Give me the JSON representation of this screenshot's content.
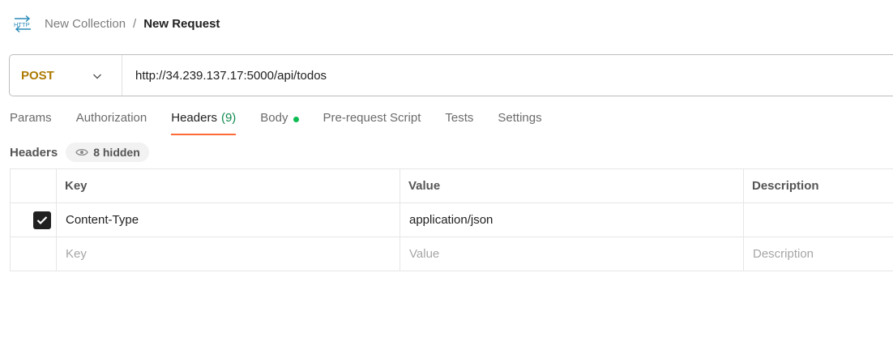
{
  "breadcrumb": {
    "icon": "http-icon",
    "collection": "New Collection",
    "separator": "/",
    "request": "New Request"
  },
  "request": {
    "method": "POST",
    "method_color": "#ad7a03",
    "url": "http://34.239.137.17:5000/api/todos"
  },
  "tabs": [
    {
      "label": "Params"
    },
    {
      "label": "Authorization"
    },
    {
      "label": "Headers",
      "count": "(9)",
      "active": true
    },
    {
      "label": "Body",
      "indicator": "green-dot"
    },
    {
      "label": "Pre-request Script"
    },
    {
      "label": "Tests"
    },
    {
      "label": "Settings"
    }
  ],
  "headers_section": {
    "title": "Headers",
    "hidden_label": "8 hidden",
    "hidden_icon": "eye-icon"
  },
  "table": {
    "columns": [
      "Key",
      "Value",
      "Description"
    ],
    "rows": [
      {
        "checked": true,
        "key": "Content-Type",
        "value": "application/json",
        "description": ""
      }
    ],
    "placeholder": {
      "key": "Key",
      "value": "Value",
      "description": "Description"
    }
  },
  "colors": {
    "accent": "#ff6c37",
    "count_green": "#0f8b4e",
    "dot_green": "#0cbb52"
  }
}
